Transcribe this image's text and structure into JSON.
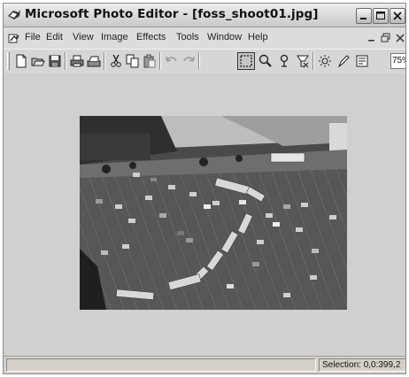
{
  "window": {
    "title": "Microsoft Photo Editor - [foss_shoot01.jpg]"
  },
  "menu": {
    "items": [
      "File",
      "Edit",
      "View",
      "Image",
      "Effects",
      "Tools",
      "Window",
      "Help"
    ]
  },
  "toolbar": {
    "zoom_value": "75%",
    "buttons": [
      "new-icon",
      "open-icon",
      "save-icon",
      "print-icon",
      "scan-icon",
      "cut-icon",
      "copy-icon",
      "paste-icon",
      "undo-icon",
      "redo-icon",
      "select-icon",
      "zoom-icon",
      "smudge-icon",
      "transparent-icon",
      "balance-icon",
      "pen-icon",
      "properties-icon"
    ]
  },
  "document": {
    "image_content": "aerial photo of a parking lot with buses and cars"
  },
  "status": {
    "selection": "Selection: 0,0:399,2"
  },
  "colors": {
    "window_bg": "#d4d0c8",
    "client_bg": "#d0d0d0",
    "title_gradient_top": "#ededed",
    "title_gradient_bottom": "#c9c9c9"
  }
}
